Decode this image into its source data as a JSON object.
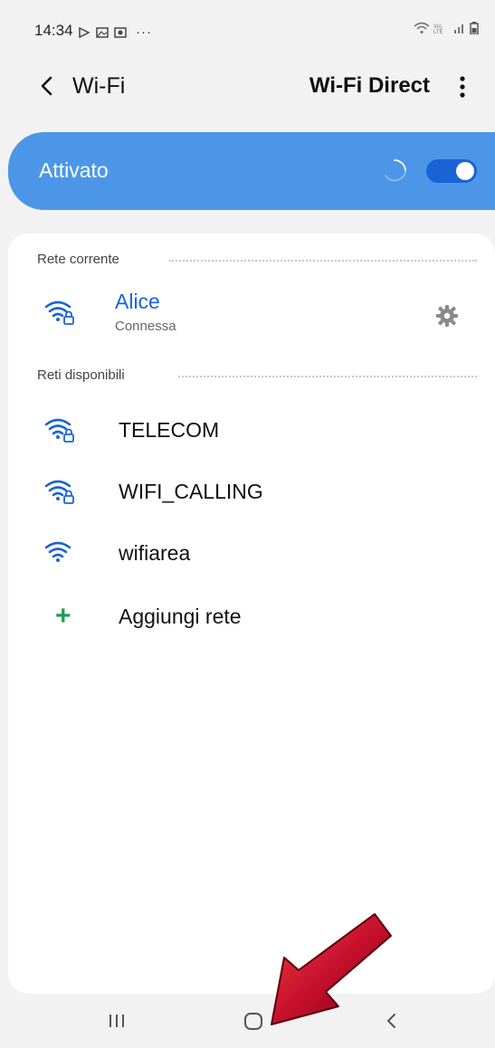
{
  "status_bar": {
    "time": "14:34",
    "dots": "···"
  },
  "header": {
    "title": "Wi-Fi",
    "wifi_direct_label": "Wi-Fi Direct"
  },
  "toggle": {
    "label": "Attivato",
    "enabled": true
  },
  "current_network": {
    "section_label": "Rete corrente",
    "name": "Alice",
    "status": "Connessa"
  },
  "available_networks": {
    "section_label": "Reti disponibili",
    "items": [
      {
        "name": "TELECOM",
        "secured": true
      },
      {
        "name": "WIFI_CALLING",
        "secured": true
      },
      {
        "name": "wifiarea",
        "secured": false
      }
    ],
    "add_label": "Aggiungi rete"
  },
  "colors": {
    "accent": "#4c96e8",
    "toggle_on": "#1a63d6",
    "connected_text": "#1a63d6",
    "add_icon": "#1e9e4f",
    "annotation_arrow": "#c8102e"
  }
}
